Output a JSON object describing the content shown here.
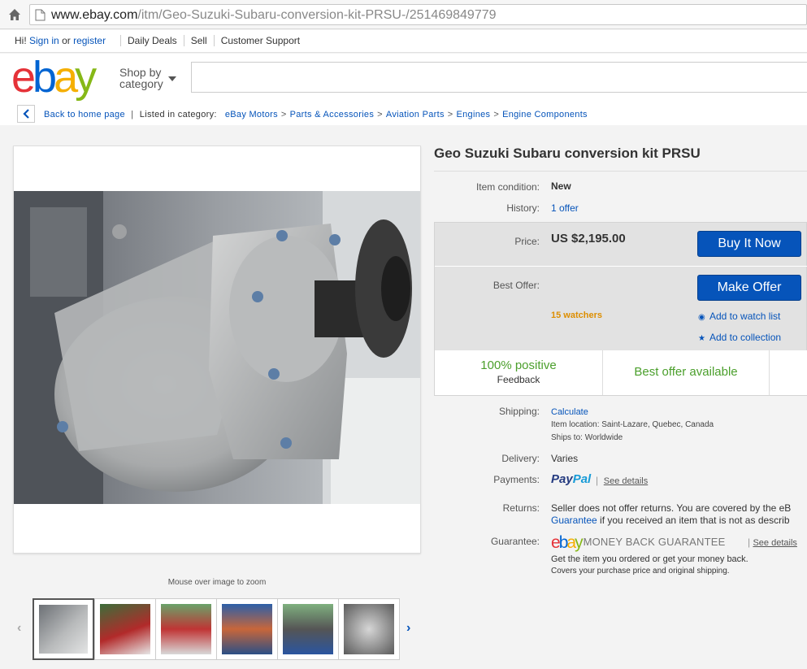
{
  "browser": {
    "url_host": "www.ebay.com",
    "url_path": "/itm/Geo-Suzuki-Subaru-conversion-kit-PRSU-/251469849779"
  },
  "toplinks": {
    "greeting": "Hi!",
    "sign_in": "Sign in",
    "or": "or",
    "register": "register",
    "daily_deals": "Daily Deals",
    "sell": "Sell",
    "customer_support": "Customer Support"
  },
  "header": {
    "logo_e": "e",
    "logo_b": "b",
    "logo_a": "a",
    "logo_y": "y",
    "shop_by_line1": "Shop by",
    "shop_by_line2": "category",
    "search_value": ""
  },
  "breadcrumb": {
    "back": "Back to home page",
    "listed_in": "Listed in category:",
    "items": [
      "eBay Motors",
      "Parts & Accessories",
      "Aviation Parts",
      "Engines",
      "Engine Components"
    ]
  },
  "gallery": {
    "zoom_hint": "Mouse over image to zoom"
  },
  "item": {
    "title": "Geo Suzuki Subaru conversion kit PRSU",
    "condition_label": "Item condition:",
    "condition_value": "New",
    "history_label": "History:",
    "history_value": "1 offer",
    "price_label": "Price:",
    "price_value": "US $2,195.00",
    "buy_now": "Buy It Now",
    "best_offer_label": "Best Offer:",
    "make_offer": "Make Offer",
    "watchers": "15 watchers",
    "add_watch": "Add to watch list",
    "add_collection": "Add to collection",
    "feedback_pct": "100% positive",
    "feedback_label": "Feedback",
    "best_offer_available": "Best offer available",
    "shipping_label": "Shipping:",
    "shipping_value": "Calculate",
    "item_location": "Item location:  Saint-Lazare, Quebec, Canada",
    "ships_to": "Ships to:  Worldwide",
    "delivery_label": "Delivery:",
    "delivery_value": "Varies",
    "payments_label": "Payments:",
    "paypal_1": "Pay",
    "paypal_2": "Pal",
    "see_details": "See details",
    "returns_label": "Returns:",
    "returns_line1": "Seller does not offer returns. You are covered by the eB",
    "returns_line2_link": "Guarantee",
    "returns_line2_rest": " if you received an item that is not as describ",
    "guarantee_label": "Guarantee:",
    "mbg_text": "MONEY BACK GUARANTEE",
    "see_details_2": "See details",
    "guarantee_line1": "Get the item you ordered or get your money back.",
    "guarantee_line2": "Covers your purchase price and original shipping."
  },
  "colors": {
    "link": "#0654ba",
    "button": "#0654ba",
    "positive_green": "#4b9f2c",
    "watchers_orange": "#dd8e00"
  }
}
